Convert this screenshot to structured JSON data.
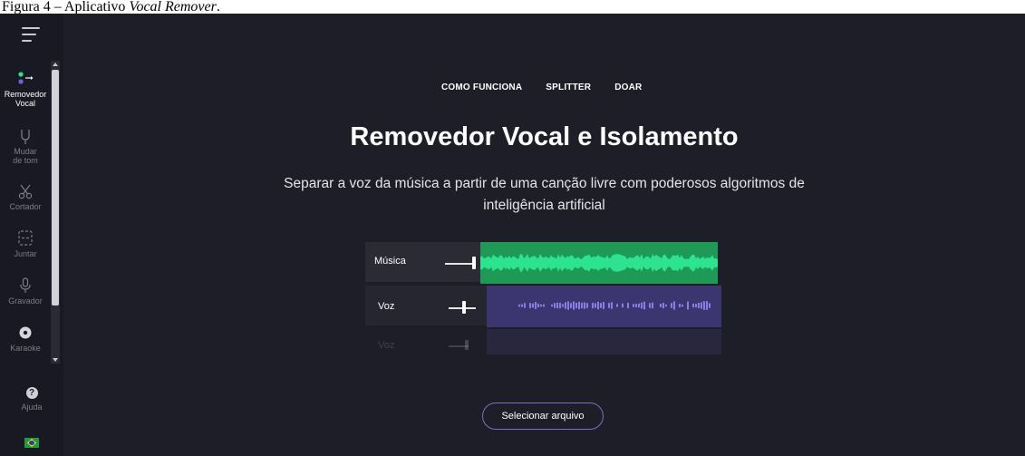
{
  "caption": {
    "prefix": "Figura 4 – Aplicativo ",
    "app_name": "Vocal Remover",
    "suffix": "."
  },
  "sidebar": {
    "items": [
      {
        "line1": "Removedor",
        "line2": "Vocal",
        "icon": "remover-dots-icon",
        "active": true
      },
      {
        "line1": "Mudar",
        "line2": "de tom",
        "icon": "tuning-fork-icon",
        "active": false
      },
      {
        "line1": "Cortador",
        "line2": "",
        "icon": "scissors-icon",
        "active": false
      },
      {
        "line1": "Juntar",
        "line2": "",
        "icon": "join-icon",
        "active": false
      },
      {
        "line1": "Gravador",
        "line2": "",
        "icon": "microphone-icon",
        "active": false
      },
      {
        "line1": "Karaoke",
        "line2": "",
        "icon": "disc-icon",
        "active": false
      }
    ],
    "help_label": "Ajuda",
    "help_glyph": "?"
  },
  "nav": {
    "how_it_works": "COMO FUNCIONA",
    "splitter": "SPLITTER",
    "donate": "DOAR"
  },
  "hero": {
    "title": "Removedor Vocal e Isolamento",
    "subtitle_line1": "Separar a voz da música a partir de uma canção livre com poderosos algoritmos de",
    "subtitle_line2": "inteligência artificial"
  },
  "mixer": {
    "tracks": [
      {
        "label": "Música",
        "level": 1.0
      },
      {
        "label": "Voz",
        "level": 0.6
      },
      {
        "label": "Voz",
        "level": 0.6
      }
    ]
  },
  "select_file_label": "Selecionar arquivo",
  "colors": {
    "background": "#1e1e28",
    "sidebar": "#191923",
    "music_wave": "#27e38a",
    "voice_wave": "#7667d4",
    "button_border": "#7a6fc0"
  }
}
